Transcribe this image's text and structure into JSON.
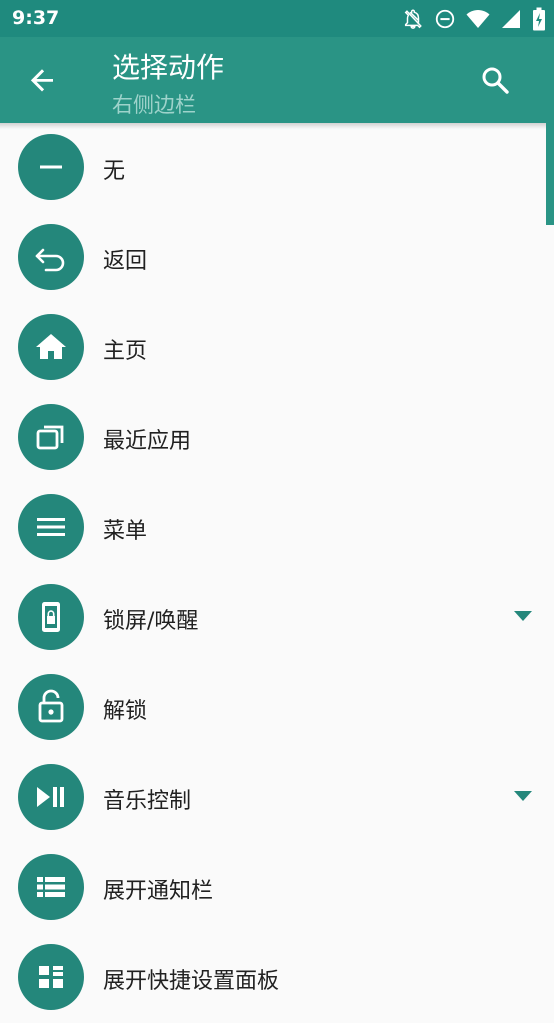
{
  "status": {
    "time": "9:37"
  },
  "appbar": {
    "title": "选择动作",
    "subtitle": "右侧边栏"
  },
  "colors": {
    "primary": "#2a9485",
    "status_bar": "#1f8a7e",
    "accent": "#24877b"
  },
  "items": [
    {
      "label": "无",
      "icon": "minus-icon",
      "expandable": false
    },
    {
      "label": "返回",
      "icon": "back-return-icon",
      "expandable": false
    },
    {
      "label": "主页",
      "icon": "home-icon",
      "expandable": false
    },
    {
      "label": "最近应用",
      "icon": "recent-apps-icon",
      "expandable": false
    },
    {
      "label": "菜单",
      "icon": "menu-icon",
      "expandable": false
    },
    {
      "label": "锁屏/唤醒",
      "icon": "lock-screen-icon",
      "expandable": true
    },
    {
      "label": "解锁",
      "icon": "unlock-icon",
      "expandable": false
    },
    {
      "label": "音乐控制",
      "icon": "play-pause-icon",
      "expandable": true
    },
    {
      "label": "展开通知栏",
      "icon": "notification-list-icon",
      "expandable": false
    },
    {
      "label": "展开快捷设置面板",
      "icon": "quick-settings-icon",
      "expandable": false
    }
  ]
}
